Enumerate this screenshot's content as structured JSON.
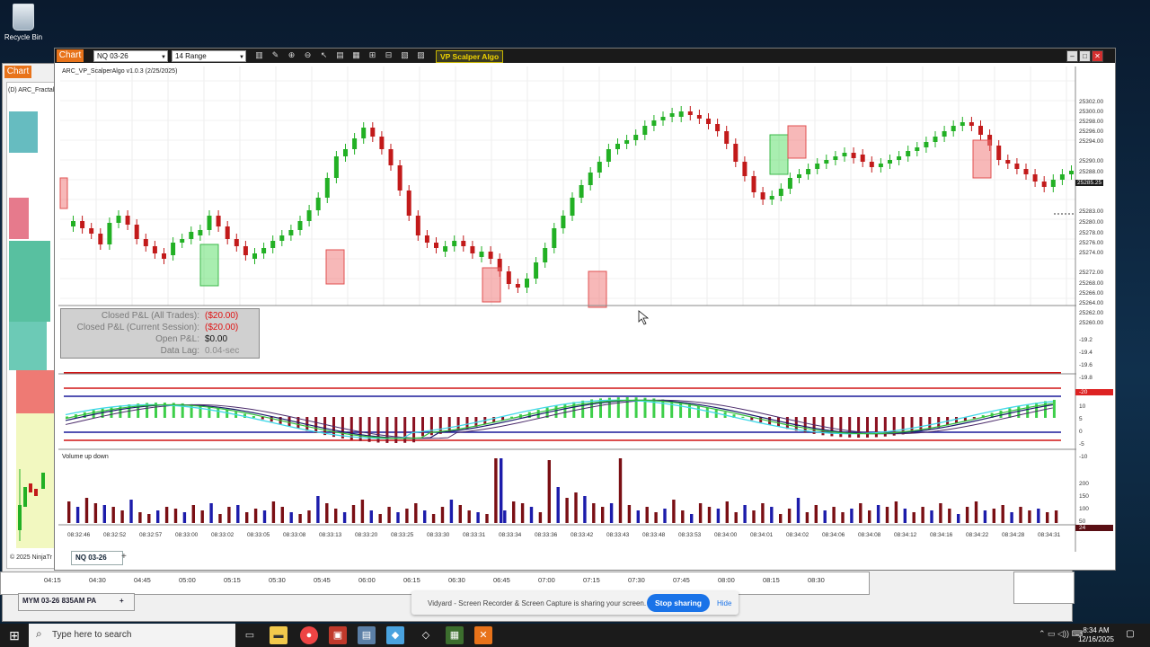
{
  "desktop": {
    "recycle_bin_label": "Recycle Bin"
  },
  "background_window": {
    "tab_label": "Chart",
    "indicator_label": "(D) ARC_Fractal",
    "copyright": "© 2025 NinjaTr",
    "time_ticks": [
      "04:15",
      "04:30",
      "04:45",
      "05:00",
      "05:15",
      "05:30",
      "05:45",
      "06:00",
      "06:15",
      "06:30",
      "06:45",
      "07:00",
      "07:15",
      "07:30",
      "07:45",
      "08:00",
      "08:15",
      "08:30"
    ],
    "instrument_tab": "MYM 03-26 835AM PA",
    "add_tab": "+"
  },
  "main_window": {
    "chart_label": "Chart",
    "instrument": "NQ 03-26",
    "bar_type": "14 Range",
    "algo_button": "VP Scalper Algo",
    "indicator_title": "ARC_VP_ScalperAlgo v1.0.3 (2/25/2025)",
    "volume_title": "Volume up down",
    "instrument_tab": "NQ 03-26",
    "add_tab": "+"
  },
  "pnl": [
    {
      "label": "Closed P&L (All Trades):",
      "value": "($20.00)",
      "color": "#e01010"
    },
    {
      "label": "Closed P&L (Current Session):",
      "value": "($20.00)",
      "color": "#e01010"
    },
    {
      "label": "Open P&L:",
      "value": "$0.00",
      "color": "#111111"
    },
    {
      "label": "Data Lag:",
      "value": "0.04-sec",
      "color": "#8a8a8a"
    }
  ],
  "price_axis": [
    "25302.00",
    "25300.00",
    "25298.00",
    "25296.00",
    "25294.00",
    "25290.00",
    "25288.00",
    "25286.00",
    "25285.25",
    "25283.00",
    "25280.00",
    "25278.00",
    "25276.00",
    "25274.00",
    "25272.00",
    "25268.00",
    "25266.00",
    "25264.00",
    "25262.00",
    "25260.00"
  ],
  "current_price": "25285.25",
  "mid_axis": [
    "-19.2",
    "-19.4",
    "-19.6",
    "-19.8"
  ],
  "osc_axis": [
    "-20",
    "10",
    "5",
    "0",
    "-5",
    "-10"
  ],
  "vol_axis": [
    "200",
    "150",
    "100",
    "50"
  ],
  "vol_current": "24",
  "time_axis": [
    "08:32:46",
    "08:32:52",
    "08:32:57",
    "08:33:00",
    "08:33:02",
    "08:33:05",
    "08:33:08",
    "08:33:13",
    "08:33:20",
    "08:33:25",
    "08:33:30",
    "08:33:31",
    "08:33:34",
    "08:33:36",
    "08:33:42",
    "08:33:43",
    "08:33:48",
    "08:33:53",
    "08:34:00",
    "08:34:01",
    "08:34:02",
    "08:34:06",
    "08:34:08",
    "08:34:12",
    "08:34:16",
    "08:34:22",
    "08:34:28",
    "08:34:31"
  ],
  "share_bar": {
    "message": "Vidyard - Screen Recorder & Screen Capture is sharing your screen.",
    "stop_label": "Stop sharing",
    "hide_label": "Hide"
  },
  "taskbar": {
    "search_placeholder": "Type here to search",
    "time": "8:34 AM",
    "date": "12/16/2025"
  },
  "colors": {
    "up": "#22b024",
    "down": "#c21a1a",
    "accent": "#e8731a",
    "algo": "#f1d400"
  }
}
